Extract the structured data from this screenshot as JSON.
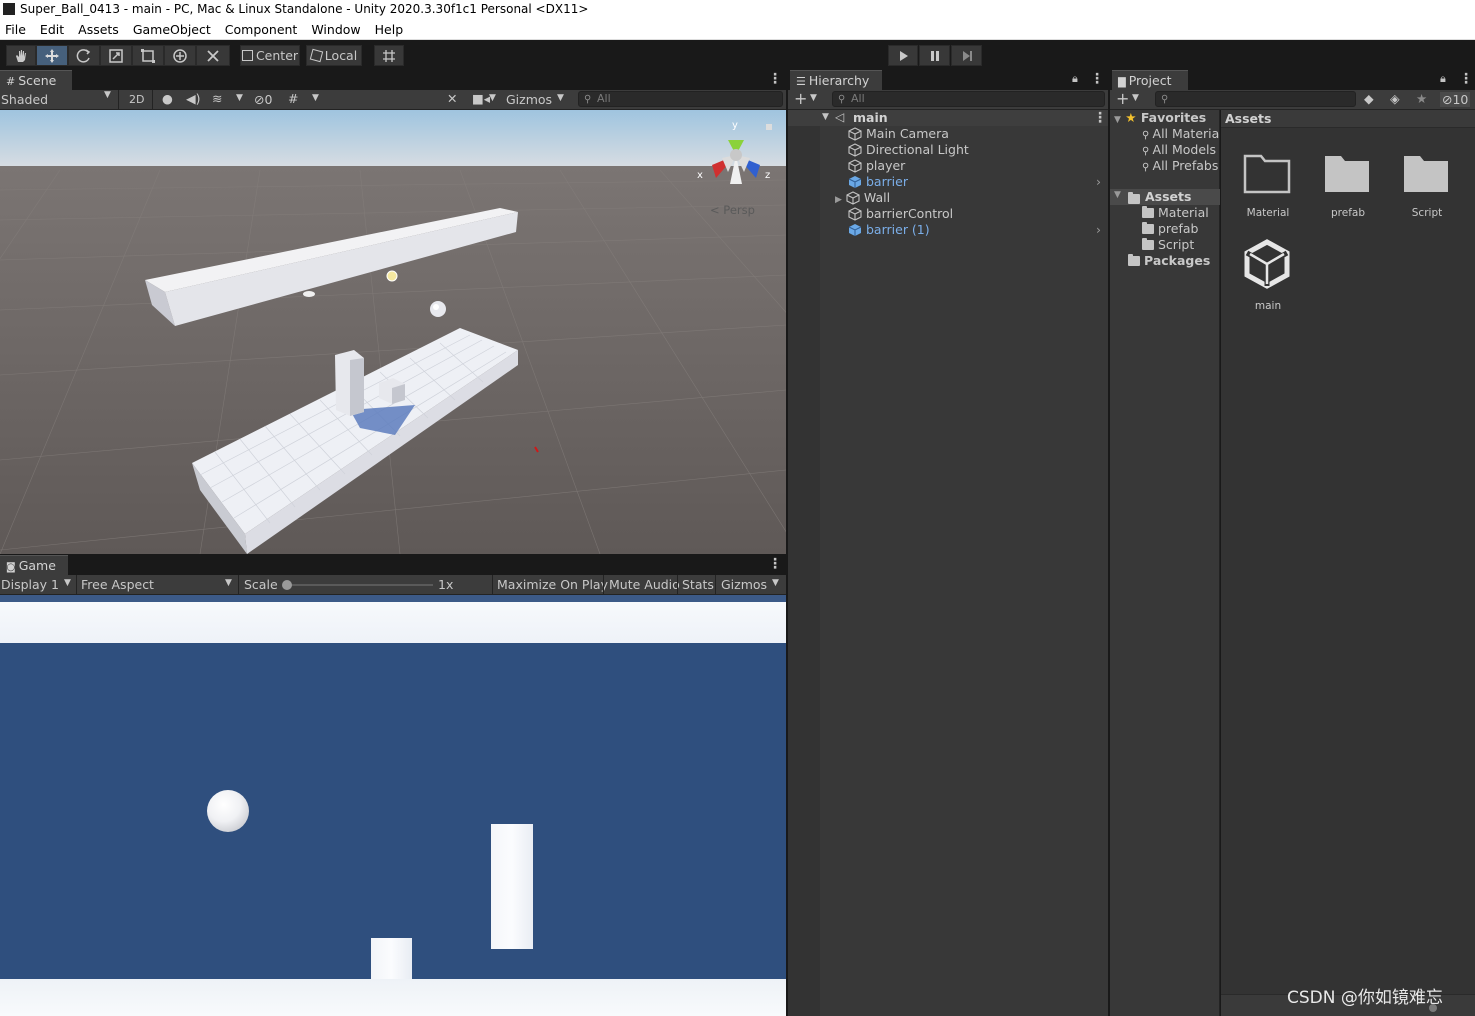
{
  "window": {
    "title": "Super_Ball_0413 - main - PC, Mac & Linux Standalone - Unity 2020.3.30f1c1 Personal <DX11>"
  },
  "menu": [
    "File",
    "Edit",
    "Assets",
    "GameObject",
    "Component",
    "Window",
    "Help"
  ],
  "toolbar": {
    "pivot_label": "Center",
    "space_label": "Local"
  },
  "scene": {
    "tab_label": "Scene",
    "shading_mode": "Shaded",
    "mode_2d": "2D",
    "hidden_count": "0",
    "gizmos_label": "Gizmos",
    "search_placeholder": "All",
    "persp_label": "Persp",
    "axis_x": "x",
    "axis_y": "y",
    "axis_z": "z"
  },
  "game": {
    "tab_label": "Game",
    "display": "Display 1",
    "aspect": "Free Aspect",
    "scale_label": "Scale",
    "scale_value": "1x",
    "maximize_label": "Maximize On Play",
    "mute_label": "Mute Audio",
    "stats_label": "Stats",
    "gizmos_label": "Gizmos"
  },
  "hierarchy": {
    "tab_label": "Hierarchy",
    "search_placeholder": "All",
    "scene_name": "main",
    "items": [
      {
        "label": "Main Camera",
        "prefab": false
      },
      {
        "label": "Directional Light",
        "prefab": false
      },
      {
        "label": "player",
        "prefab": false
      },
      {
        "label": "barrier",
        "prefab": true
      },
      {
        "label": "Wall",
        "prefab": false
      },
      {
        "label": "barrierControl",
        "prefab": false
      },
      {
        "label": "barrier (1)",
        "prefab": true
      }
    ]
  },
  "project": {
    "tab_label": "Project",
    "hidden_count": "10",
    "favorites_label": "Favorites",
    "favorites": [
      "All Materia",
      "All Models",
      "All Prefabs"
    ],
    "assets_label": "Assets",
    "asset_folders": [
      "Material",
      "prefab",
      "Script"
    ],
    "packages_label": "Packages",
    "breadcrumb": "Assets",
    "grid_items": [
      "Material",
      "prefab",
      "Script",
      "main"
    ]
  },
  "watermark": "CSDN @你如镜难忘",
  "colors": {
    "accent_blue": "#7baee8",
    "game_background": "#2f4f7e",
    "scene_ground": "#6b6462",
    "active_tool": "#46607c"
  }
}
